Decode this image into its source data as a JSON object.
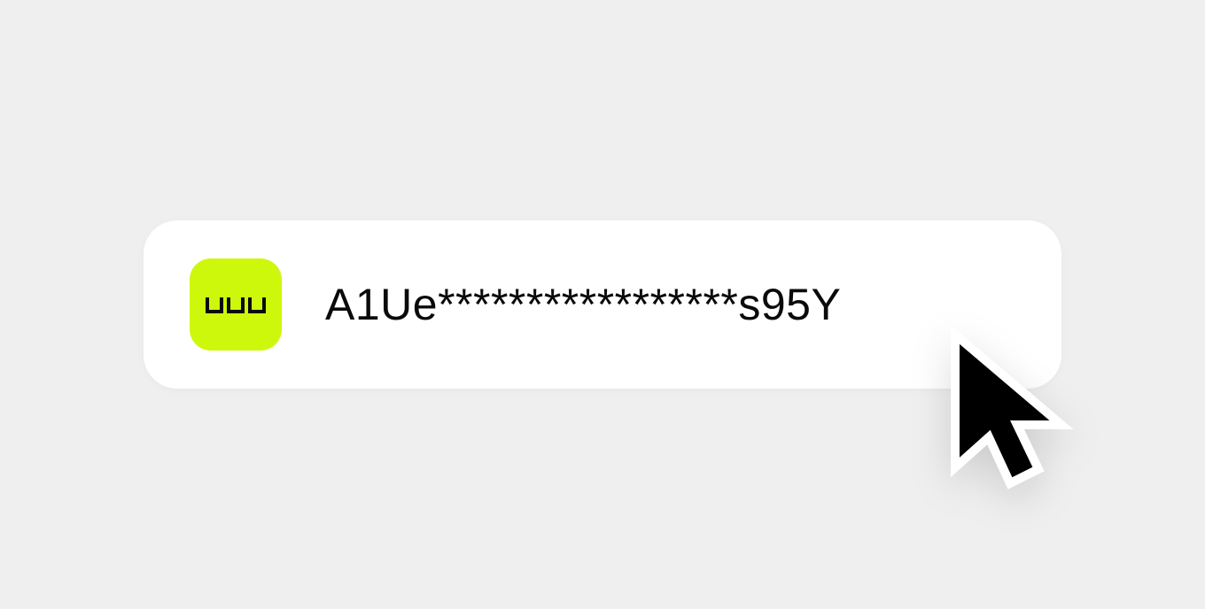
{
  "logo": {
    "name": "uuu",
    "color": "#cdf80c"
  },
  "api_key": {
    "masked_value": "A1Ue*****************s95Y"
  },
  "colors": {
    "background": "#efefef",
    "card": "#ffffff",
    "text": "#0a0a0a",
    "accent": "#cdf80c"
  },
  "icons": {
    "cursor": "arrow-pointer-icon"
  }
}
